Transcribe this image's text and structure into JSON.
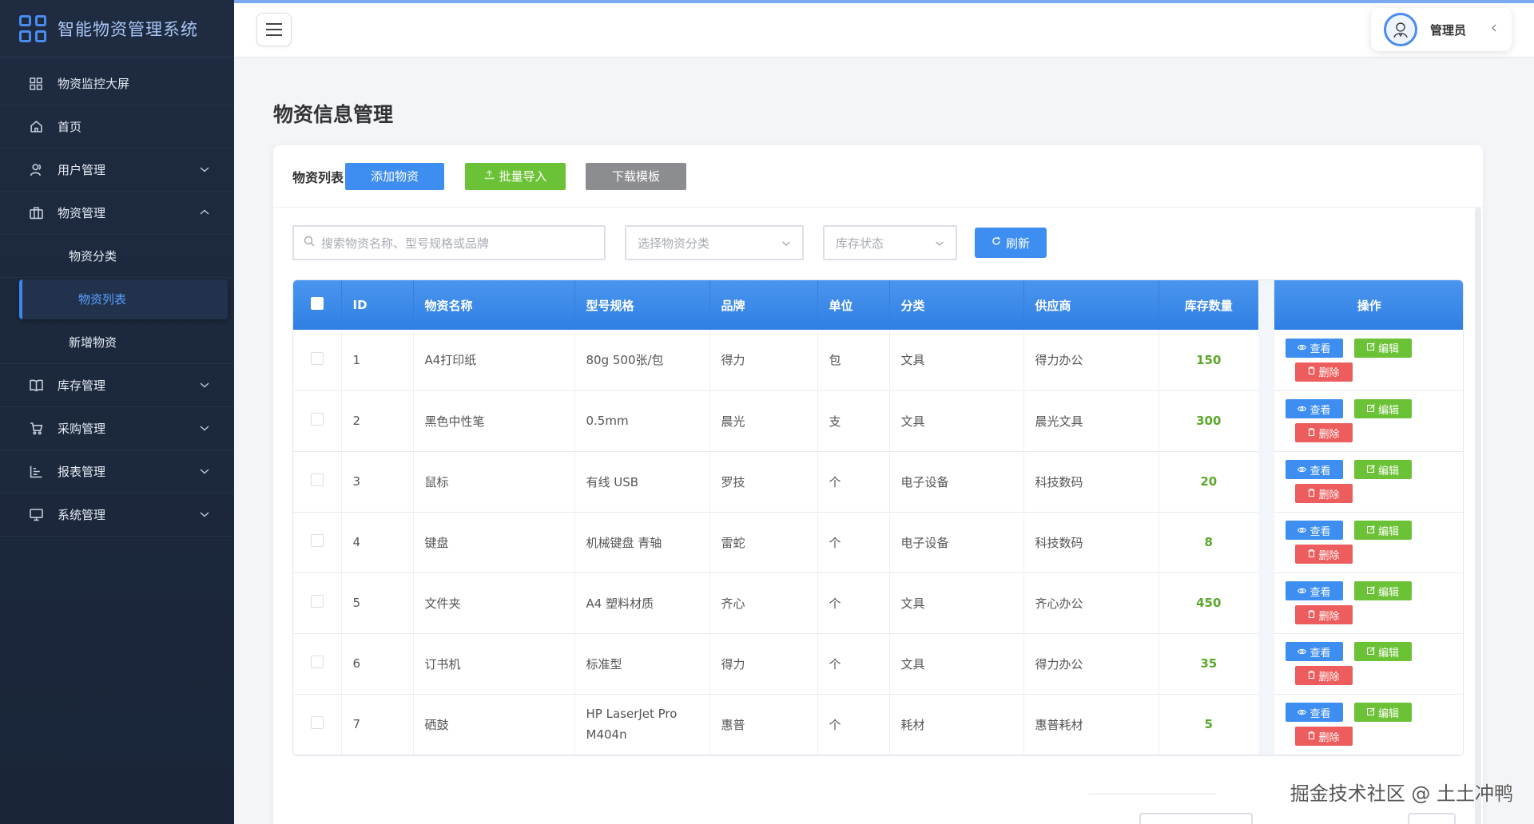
{
  "app": {
    "title": "智能物资管理系统"
  },
  "sidebar": {
    "items": [
      {
        "label": "物资监控大屏",
        "icon": "dashboard-grid-icon"
      },
      {
        "label": "首页",
        "icon": "home-icon"
      },
      {
        "label": "用户管理",
        "icon": "user-icon",
        "expanded": false
      },
      {
        "label": "物资管理",
        "icon": "briefcase-icon",
        "expanded": true,
        "children": [
          "物资分类",
          "物资列表",
          "新增物资"
        ]
      },
      {
        "label": "库存管理",
        "icon": "book-icon",
        "expanded": false
      },
      {
        "label": "采购管理",
        "icon": "cart-icon",
        "expanded": false
      },
      {
        "label": "报表管理",
        "icon": "chart-icon",
        "expanded": false
      },
      {
        "label": "系统管理",
        "icon": "monitor-icon",
        "expanded": false
      }
    ],
    "active_child": "物资列表"
  },
  "header": {
    "user_name": "管理员"
  },
  "page": {
    "title": "物资信息管理"
  },
  "toolbar": {
    "list_title": "物资列表",
    "add_label": "添加物资",
    "import_label": "批量导入",
    "download_label": "下载模板"
  },
  "filters": {
    "search_placeholder": "搜索物资名称、型号规格或品牌",
    "category_placeholder": "选择物资分类",
    "stock_placeholder": "库存状态",
    "refresh_label": "刷新"
  },
  "table": {
    "columns": [
      "ID",
      "物资名称",
      "型号规格",
      "品牌",
      "单位",
      "分类",
      "供应商",
      "库存数量",
      "操作"
    ],
    "rows": [
      {
        "id": "1",
        "name": "A4打印纸",
        "model": "80g 500张/包",
        "brand": "得力",
        "unit": "包",
        "category": "文具",
        "supplier": "得力办公",
        "stock": "150"
      },
      {
        "id": "2",
        "name": "黑色中性笔",
        "model": "0.5mm",
        "brand": "晨光",
        "unit": "支",
        "category": "文具",
        "supplier": "晨光文具",
        "stock": "300"
      },
      {
        "id": "3",
        "name": "鼠标",
        "model": "有线 USB",
        "brand": "罗技",
        "unit": "个",
        "category": "电子设备",
        "supplier": "科技数码",
        "stock": "20"
      },
      {
        "id": "4",
        "name": "键盘",
        "model": "机械键盘 青轴",
        "brand": "雷蛇",
        "unit": "个",
        "category": "电子设备",
        "supplier": "科技数码",
        "stock": "8"
      },
      {
        "id": "5",
        "name": "文件夹",
        "model": "A4 塑料材质",
        "brand": "齐心",
        "unit": "个",
        "category": "文具",
        "supplier": "齐心办公",
        "stock": "450"
      },
      {
        "id": "6",
        "name": "订书机",
        "model": "标准型",
        "brand": "得力",
        "unit": "个",
        "category": "文具",
        "supplier": "得力办公",
        "stock": "35"
      },
      {
        "id": "7",
        "name": "硒鼓",
        "model": "HP LaserJet Pro M404n",
        "brand": "惠普",
        "unit": "个",
        "category": "耗材",
        "supplier": "惠普耗材",
        "stock": "5"
      }
    ],
    "actions": {
      "view": "查看",
      "edit": "编辑",
      "delete": "删除"
    }
  },
  "watermark": "掘金技术社区 @ 土土冲鸭",
  "colors": {
    "primary": "#3d8ef0",
    "success": "#6cc236",
    "danger": "#ee5d5d",
    "sidebar_bg": "#1e2b40",
    "stock_text": "#5aa82a"
  }
}
